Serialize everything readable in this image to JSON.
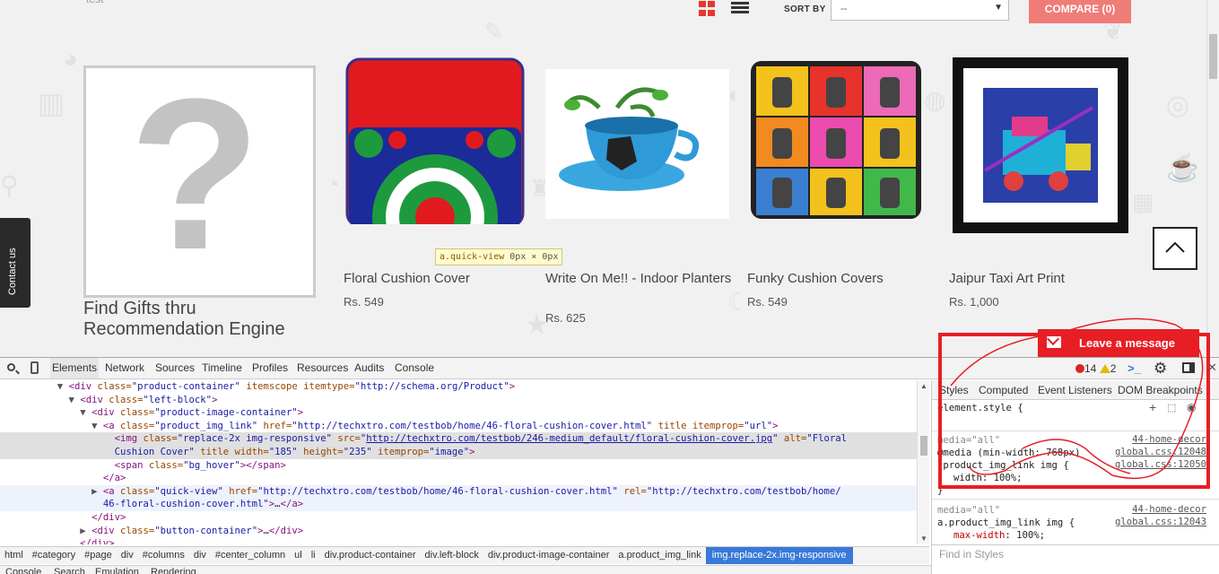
{
  "site": {
    "top_text": "test",
    "sort_label": "SORT BY",
    "sort_value": "--",
    "compare_label": "COMPARE (0)",
    "side_tab_label": "Contact us",
    "reco_title": "Find Gifts thru Recommendation Engine",
    "reco_symbol": "?",
    "tooltip_selector": "a.quick-view",
    "tooltip_size": "0px × 0px",
    "leave_message": "Leave a message",
    "products": [
      {
        "name": "Floral Cushion Cover",
        "price": "Rs. 549"
      },
      {
        "name": "Write On Me!! - Indoor Planters",
        "price": "Rs. 625"
      },
      {
        "name": "Funky Cushion Covers",
        "price": "Rs. 549"
      },
      {
        "name": "Jaipur Taxi Art Print",
        "price": "Rs. 1,000"
      }
    ],
    "colors": {
      "accent": "#e8362d",
      "compare": "#f07c78",
      "leave_message": "#e81e25"
    }
  },
  "devtools": {
    "tabs": [
      "Elements",
      "Network",
      "Sources",
      "Timeline",
      "Profiles",
      "Resources",
      "Audits",
      "Console"
    ],
    "error_count": "14",
    "warning_count": "2",
    "code_lines": [
      {
        "indent": "          ",
        "tri": "▼",
        "html": "<span class=\"tag\">&lt;div</span> <span class=\"attr\">class=</span><span class=\"val\">\"product-container\"</span> <span class=\"attr\">itemscope itemtype=</span><span class=\"val\">\"http://schema.org/Product\"</span><span class=\"tag\">&gt;</span>"
      },
      {
        "indent": "            ",
        "tri": "▼",
        "html": "<span class=\"tag\">&lt;div</span> <span class=\"attr\">class=</span><span class=\"val\">\"left-block\"</span><span class=\"tag\">&gt;</span>"
      },
      {
        "indent": "              ",
        "tri": "▼",
        "html": "<span class=\"tag\">&lt;div</span> <span class=\"attr\">class=</span><span class=\"val\">\"product-image-container\"</span><span class=\"tag\">&gt;</span>"
      },
      {
        "indent": "                ",
        "tri": "▼",
        "html": "<span class=\"tag\">&lt;a</span> <span class=\"attr\">class=</span><span class=\"val\">\"product_img_link\"</span> <span class=\"attr\">href=</span><span class=\"val\">\"http://techxtro.com/testbob/home/46-floral-cushion-cover.html\"</span> <span class=\"attr\">title itemprop=</span><span class=\"val\">\"url\"</span><span class=\"tag\">&gt;</span>"
      },
      {
        "indent": "                  ",
        "tri": "",
        "html": "<span class=\"tag\">&lt;img</span> <span class=\"attr\">class=</span><span class=\"val\">\"replace-2x img-responsive\"</span> <span class=\"attr\">src=</span><span class=\"val\">\"<span class=\"link\">http://techxtro.com/testbob/246-medium_default/floral-cushion-cover.jpg</span>\"</span> <span class=\"attr\">alt=</span><span class=\"val\">\"Floral</span>"
      },
      {
        "indent": "                  ",
        "tri": "",
        "html": "<span class=\"val\">Cushion Cover\"</span> <span class=\"attr\">title width=</span><span class=\"val\">\"185\"</span> <span class=\"attr\">height=</span><span class=\"val\">\"235\"</span> <span class=\"attr\">itemprop=</span><span class=\"val\">\"image\"</span><span class=\"tag\">&gt;</span>"
      },
      {
        "indent": "                  ",
        "tri": "",
        "html": "<span class=\"tag\">&lt;span</span> <span class=\"attr\">class=</span><span class=\"val\">\"bg_hover\"</span><span class=\"tag\">&gt;&lt;/span&gt;</span>"
      },
      {
        "indent": "                ",
        "tri": "",
        "html": "<span class=\"tag\">&lt;/a&gt;</span>"
      },
      {
        "indent": "                ",
        "tri": "▶",
        "html": "<span class=\"tag\">&lt;a</span> <span class=\"attr\">class=</span><span class=\"val\">\"quick-view\"</span> <span class=\"attr\">href=</span><span class=\"val\">\"http://techxtro.com/testbob/home/46-floral-cushion-cover.html\"</span> <span class=\"attr\">rel=</span><span class=\"val\">\"http://techxtro.com/testbob/home/</span>"
      },
      {
        "indent": "                ",
        "tri": "",
        "html": "<span class=\"val\">46-floral-cushion-cover.html\"</span><span class=\"tag\">&gt;</span>…<span class=\"tag\">&lt;/a&gt;</span>"
      },
      {
        "indent": "              ",
        "tri": "",
        "html": "<span class=\"tag\">&lt;/div&gt;</span>"
      },
      {
        "indent": "              ",
        "tri": "▶",
        "html": "<span class=\"tag\">&lt;div</span> <span class=\"attr\">class=</span><span class=\"val\">\"button-container\"</span><span class=\"tag\">&gt;</span>…<span class=\"tag\">&lt;/div&gt;</span>"
      },
      {
        "indent": "            ",
        "tri": "",
        "html": "<span class=\"tag\">&lt;/div&gt;</span>"
      }
    ],
    "breadcrumbs": [
      "html",
      "#category",
      "#page",
      "div",
      "#columns",
      "div",
      "#center_column",
      "ul",
      "li",
      "div.product-container",
      "div.left-block",
      "div.product-image-container",
      "a.product_img_link",
      "img.replace-2x.img-responsive"
    ],
    "drawer_tabs": [
      "Console",
      "Search",
      "Emulation",
      "Rendering"
    ],
    "styles_tabs": [
      "Styles",
      "Computed",
      "Event Listeners",
      "DOM Breakpoints"
    ],
    "element_style": "element.style {",
    "rule1_media": "media=\"all\"",
    "rule1_src1": "44-home-decor",
    "rule1_media2": "@media (min-width: 768px)",
    "rule1_src2": "global.css:12048",
    "rule1_selector": ".product_img_link img {",
    "rule1_src3": "global.css:12050",
    "rule1_prop": "width: 100%;",
    "rule_close": "}",
    "rule2_media": "media=\"all\"",
    "rule2_src1": "44-home-decor",
    "rule2_selector": "a.product_img_link img {",
    "rule2_src2": "global.css:12043",
    "rule2_prop_name": "max-width",
    "rule2_prop_val": "100%;",
    "find_placeholder": "Find in Styles"
  }
}
